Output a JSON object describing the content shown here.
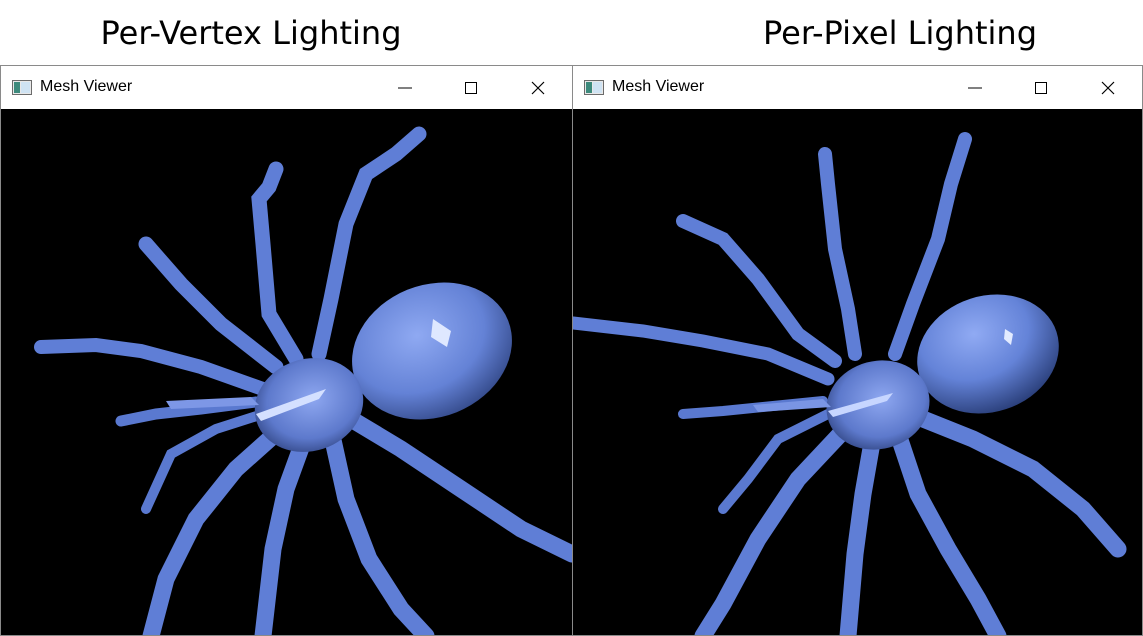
{
  "captions": {
    "left": "Per-Vertex Lighting",
    "right": "Per-Pixel Lighting"
  },
  "windows": [
    {
      "title": "Mesh Viewer",
      "icon": "app-window-icon",
      "controls": [
        "minimize-icon",
        "maximize-icon",
        "close-icon"
      ],
      "viewport_background": "#000000",
      "mesh_color": "#6f8fe0"
    },
    {
      "title": "Mesh Viewer",
      "icon": "app-window-icon",
      "controls": [
        "minimize-icon",
        "maximize-icon",
        "close-icon"
      ],
      "viewport_background": "#000000",
      "mesh_color": "#6f8fe0"
    }
  ]
}
